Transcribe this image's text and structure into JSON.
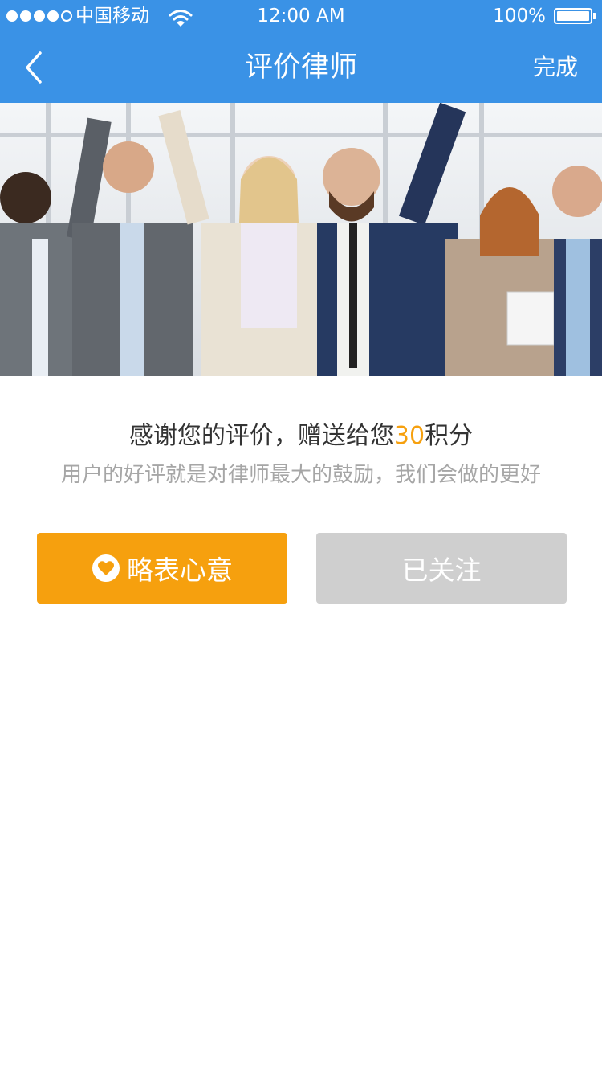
{
  "status_bar": {
    "carrier": "中国移动",
    "time": "12:00 AM",
    "battery": "100%",
    "icons": [
      "signal-icon",
      "wifi-icon",
      "battery-icon"
    ]
  },
  "nav": {
    "title": "评价律师",
    "done_label": "完成",
    "back_icon": "chevron-left-icon"
  },
  "banner": {
    "description_icon": "team-celebration-photo"
  },
  "message": {
    "thanks_prefix": "感谢您的评价，赠送给您",
    "points": "30",
    "thanks_suffix": "积分",
    "subtitle": "用户的好评就是对律师最大的鼓励，我们会做的更好"
  },
  "actions": {
    "tip_label": "略表心意",
    "tip_icon": "heart-icon",
    "follow_label": "已关注"
  },
  "colors": {
    "header": "#3a92e6",
    "accent": "#f6a00e",
    "disabled": "#cfcfcf",
    "subtitle": "#a6a6a6"
  }
}
